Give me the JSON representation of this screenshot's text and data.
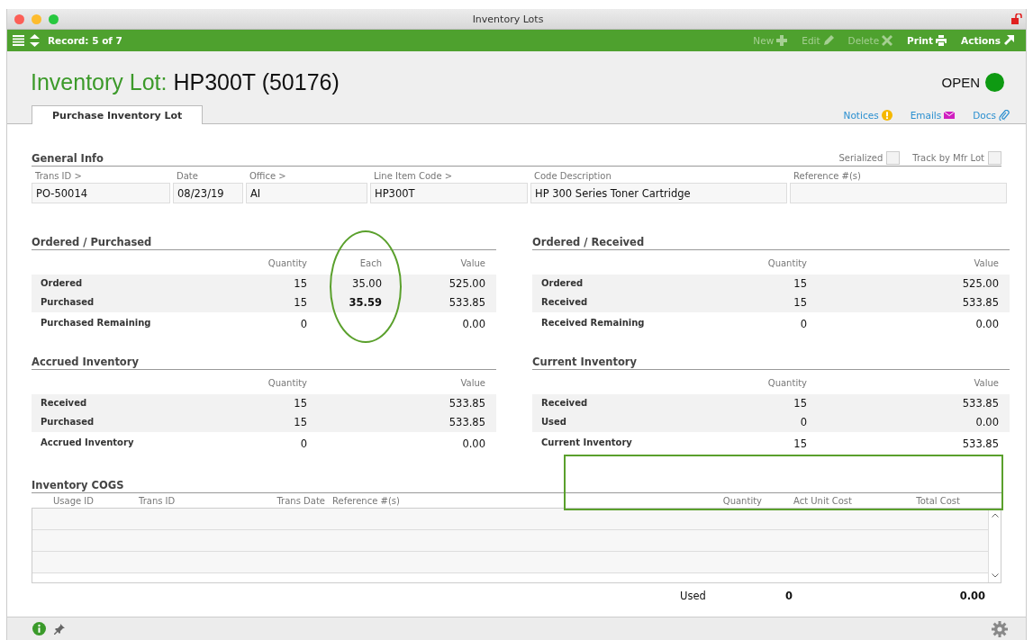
{
  "window": {
    "title": "Inventory Lots"
  },
  "toolbar": {
    "record": "Record: 5 of 7",
    "actions": [
      {
        "label": "New",
        "kind": "new",
        "disabled": true
      },
      {
        "label": "Edit",
        "kind": "edit",
        "disabled": true
      },
      {
        "label": "Delete",
        "kind": "delete",
        "disabled": true
      },
      {
        "label": "Print",
        "kind": "print",
        "disabled": false
      },
      {
        "label": "Actions",
        "kind": "actions",
        "disabled": false
      }
    ]
  },
  "header": {
    "prefix": "Inventory Lot:",
    "title": "HP300T (50176)",
    "status": "OPEN"
  },
  "tabs": [
    {
      "label": "Purchase Inventory Lot",
      "selected": true
    }
  ],
  "links": [
    {
      "label": "Notices",
      "kind": "notices"
    },
    {
      "label": "Emails",
      "kind": "emails"
    },
    {
      "label": "Docs",
      "kind": "docs"
    }
  ],
  "general_info": {
    "title": "General Info",
    "checkboxes": [
      {
        "label": "Serialized",
        "checked": false
      },
      {
        "label": "Track by Mfr Lot",
        "checked": false
      }
    ],
    "fields": [
      {
        "label": "Trans ID >",
        "value": "PO-50014"
      },
      {
        "label": "Date",
        "value": "08/23/19"
      },
      {
        "label": "Office >",
        "value": "AI"
      },
      {
        "label": "Line Item Code >",
        "value": "HP300T"
      },
      {
        "label": "Code Description",
        "value": "HP 300 Series Toner Cartridge"
      },
      {
        "label": "Reference #(s)"
      }
    ]
  },
  "sections": [
    {
      "title": "Ordered / Purchased",
      "columns": [
        "Quantity",
        "Each",
        "Value"
      ],
      "rows": [
        {
          "label": "Ordered",
          "shaded": true,
          "cells": [
            {
              "text": "15"
            },
            {
              "text": "35.00"
            },
            {
              "text": "525.00"
            }
          ]
        },
        {
          "label": "Purchased",
          "shaded": true,
          "cells": [
            {
              "text": "15"
            },
            {
              "text": "35.59",
              "bold": true
            },
            {
              "text": "533.85"
            }
          ]
        },
        {
          "label": "Purchased Remaining",
          "shaded": false,
          "cells": [
            {
              "text": "0"
            },
            null,
            {
              "text": "0.00"
            }
          ]
        }
      ]
    },
    {
      "title": "Ordered / Received",
      "columns": [
        "Quantity",
        "Value"
      ],
      "rows": [
        {
          "label": "Ordered",
          "shaded": true,
          "cells": [
            {
              "text": "15"
            },
            {
              "text": "525.00"
            }
          ]
        },
        {
          "label": "Received",
          "shaded": true,
          "cells": [
            {
              "text": "15"
            },
            {
              "text": "533.85"
            }
          ]
        },
        {
          "label": "Received Remaining",
          "shaded": false,
          "cells": [
            {
              "text": "0"
            },
            {
              "text": "0.00"
            }
          ]
        }
      ]
    },
    {
      "title": "Accrued Inventory",
      "columns": [
        "Quantity",
        "Value"
      ],
      "rows": [
        {
          "label": "Received",
          "shaded": true,
          "cells": [
            {
              "text": "15"
            },
            {
              "text": "533.85"
            }
          ]
        },
        {
          "label": "Purchased",
          "shaded": true,
          "cells": [
            {
              "text": "15"
            },
            {
              "text": "533.85"
            }
          ]
        },
        {
          "label": "Accrued Inventory",
          "shaded": false,
          "cells": [
            {
              "text": "0"
            },
            {
              "text": "0.00"
            }
          ]
        }
      ]
    },
    {
      "title": "Current Inventory",
      "columns": [
        "Quantity",
        "Value"
      ],
      "rows": [
        {
          "label": "Received",
          "shaded": true,
          "cells": [
            {
              "text": "15"
            },
            {
              "text": "533.85"
            }
          ]
        },
        {
          "label": "Used",
          "shaded": true,
          "cells": [
            {
              "text": "0"
            },
            {
              "text": "0.00"
            }
          ]
        },
        {
          "label": "Current Inventory",
          "shaded": false,
          "cells": [
            {
              "text": "15"
            },
            {
              "text": "533.85"
            }
          ]
        }
      ]
    }
  ],
  "cogs": {
    "title": "Inventory COGS",
    "columns": [
      "Usage ID",
      "Trans ID",
      "Trans Date",
      "Reference #(s)",
      "Quantity",
      "Act Unit Cost",
      "Total Cost"
    ],
    "totals": {
      "label": "Used",
      "quantity": "0",
      "total": "0.00"
    }
  },
  "annotations": [
    {
      "kind": "ellipse"
    },
    {
      "kind": "rectangle"
    }
  ]
}
